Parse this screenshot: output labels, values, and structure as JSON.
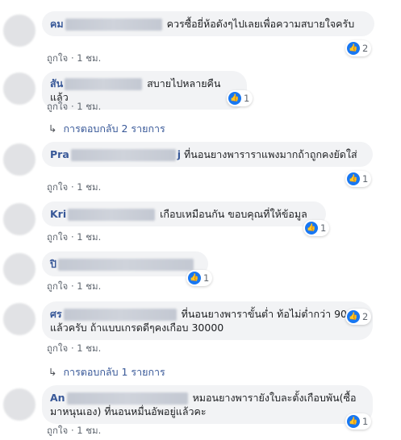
{
  "comments": [
    {
      "name": "คม",
      "text": "ควรซื้อยี่ห้อดังๆไปเลยเพื่อความสบายใจครับ",
      "like_label": "ถูกใจ",
      "time": "1 ชม.",
      "reactions": "2"
    },
    {
      "name": "สัน",
      "text": "สบายไปหลายคืนแล้ว",
      "like_label": "ถูกใจ",
      "time": "1 ชม.",
      "reactions": "1",
      "replies": "การตอบกลับ 2 รายการ"
    },
    {
      "name": "Pra",
      "name_tail": "j",
      "text": "ที่นอนยางพาราราแพงมากถ้าถูกคงยัดใส่",
      "like_label": "ถูกใจ",
      "time": "1 ชม.",
      "reactions": "1"
    },
    {
      "name": "Kri",
      "text": "เกือบเหมือนกัน ขอบคุณที่ให้ข้อมูล",
      "like_label": "ถูกใจ",
      "time": "1 ชม.",
      "reactions": "1"
    },
    {
      "name": "ปิ",
      "like_label": "ถูกใจ",
      "time": "1 ชม.",
      "reactions": "1"
    },
    {
      "name": "ศร",
      "text": "ที่นอนยางพาราขั้นต่ำ ท้อไม่ต่ำกว่า 9000 แล้วครับ ถ้าแบบเกรดดีๆคงเกือบ 30000",
      "like_label": "ถูกใจ",
      "time": "1 ชม.",
      "reactions": "2",
      "replies": "การตอบกลับ 1 รายการ"
    },
    {
      "name": "An",
      "text": "หมอนยางพารายังใบละตั้งเกือบพัน(ซื้อมาหนุนเอง) ที่นอนหมื่นอัพอยู่แล้วคะ",
      "like_label": "ถูกใจ",
      "time": "1 ชม.",
      "reactions": "1"
    }
  ],
  "separator": "·",
  "reply_arrow": "↳",
  "icons": {
    "like": "thumbs-up-icon"
  },
  "colors": {
    "accent": "#385898",
    "like_blue": "#1877f2",
    "bubble": "#f2f3f5"
  }
}
